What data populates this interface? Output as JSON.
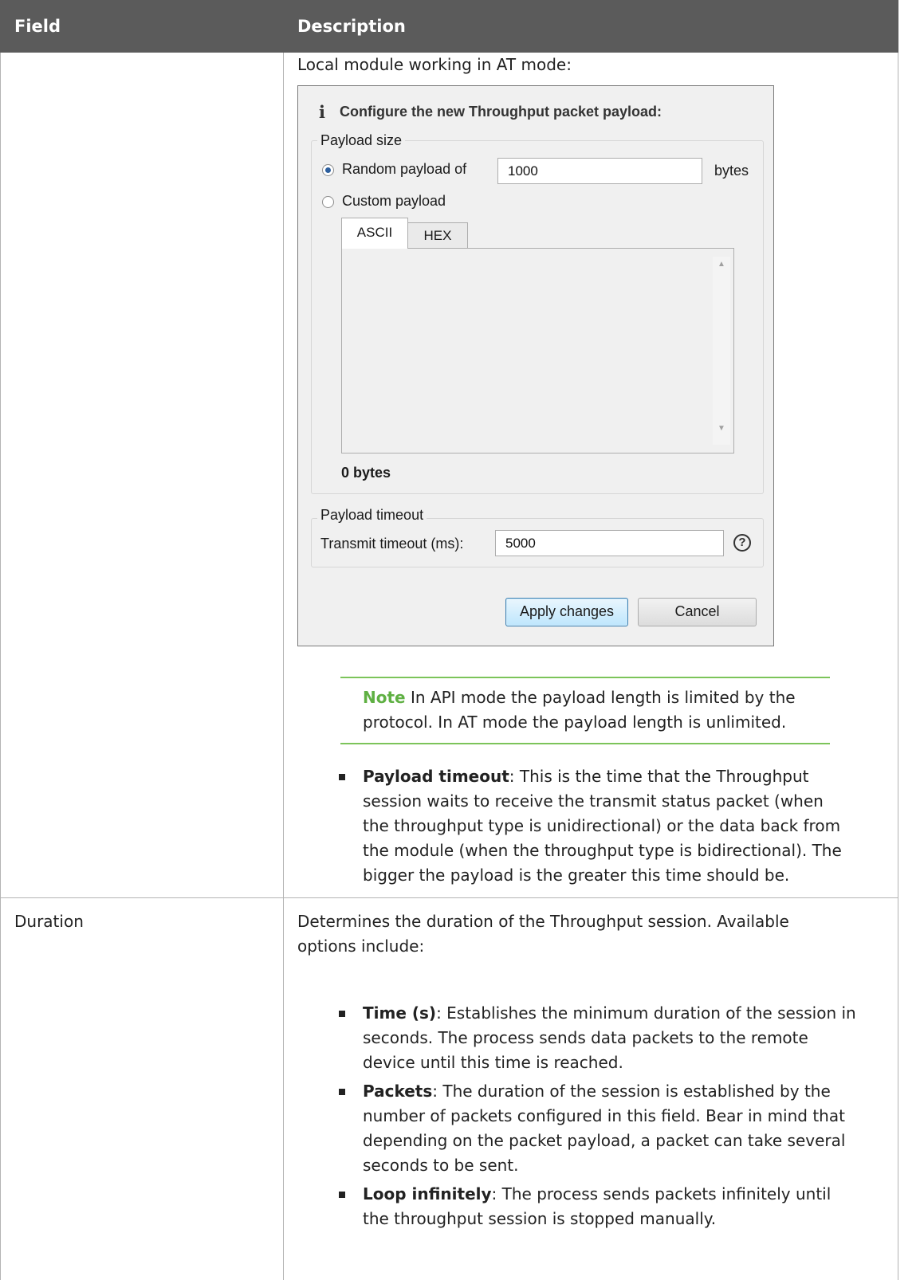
{
  "table": {
    "headers": {
      "field": "Field",
      "description": "Description"
    },
    "rows": [
      {
        "field": "",
        "intro": "Local module working in AT mode:",
        "dialog": {
          "title": "Configure the new Throughput packet payload:",
          "payload_size": {
            "legend": "Payload size",
            "random_label": "Random payload of",
            "random_value": "1000",
            "random_unit": "bytes",
            "random_selected": true,
            "custom_label": "Custom payload",
            "custom_selected": false,
            "tabs": [
              "ASCII",
              "HEX"
            ],
            "active_tab": "ASCII",
            "byte_count": "0 bytes"
          },
          "payload_timeout": {
            "legend": "Payload timeout",
            "label": "Transmit timeout (ms):",
            "value": "5000"
          },
          "buttons": {
            "apply": "Apply changes",
            "cancel": "Cancel"
          }
        },
        "note": {
          "label": "Note",
          "line1": " In API mode the payload length is limited by the",
          "line2": "protocol. In AT mode the payload length is unlimited."
        },
        "bullet": {
          "term": "Payload timeout",
          "lines": [
            ": This is the time that the Throughput",
            "session waits to receive the transmit status packet (when",
            "the throughput type is unidirectional) or the data back from",
            "the module (when the throughput type is bidirectional). The",
            "bigger the payload is the greater this time should be."
          ]
        }
      },
      {
        "field": "Duration",
        "intro_lines": [
          "Determines the duration of the Throughput session. Available",
          "options include:"
        ],
        "bullets": [
          {
            "term": "Time (s)",
            "lines": [
              ": Establishes the minimum duration of the session in",
              "seconds. The process sends data packets to the remote",
              "device until this time is reached."
            ]
          },
          {
            "term": "Packets",
            "lines": [
              ": The duration of the session is established by the",
              "number of packets configured in this field. Bear in mind that",
              "depending on the packet payload, a packet can take several",
              "seconds to be sent."
            ]
          },
          {
            "term": "Loop infinitely",
            "lines": [
              ": The process sends packets infinitely until",
              "the throughput session is stopped manually."
            ]
          }
        ]
      }
    ]
  },
  "colors": {
    "header_bg": "#5b5b5b",
    "note_accent": "#7cc45a",
    "border": "#b3b3b3"
  }
}
